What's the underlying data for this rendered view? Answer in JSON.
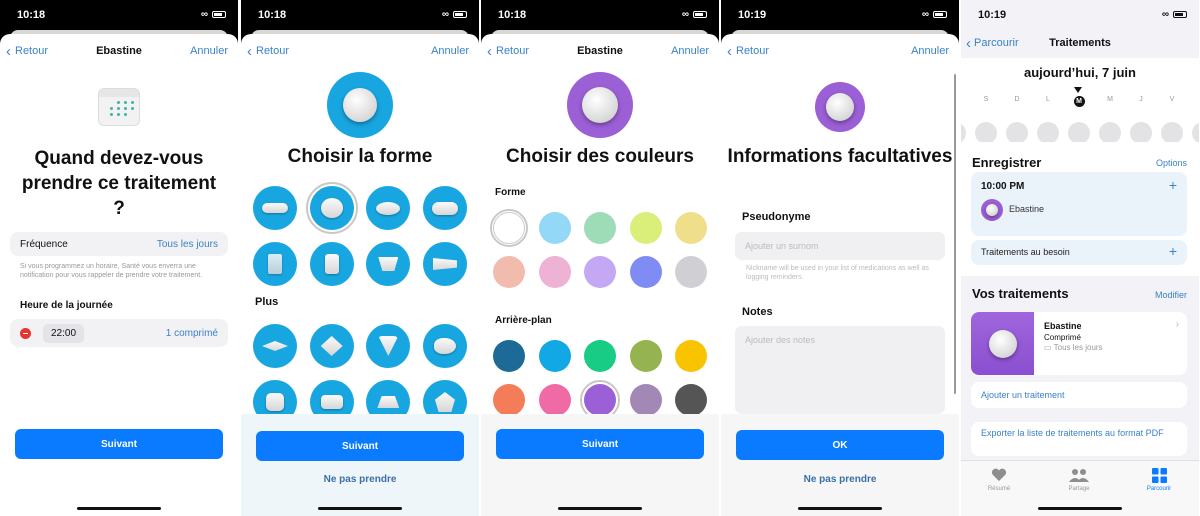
{
  "panels": [
    {
      "status_time": "10:18",
      "nav": {
        "back": "Retour",
        "title": "Ebastine",
        "cancel": "Annuler"
      },
      "heading": "Quand devez-vous prendre ce traitement ?",
      "frequency": {
        "label": "Fréquence",
        "value": "Tous les jours"
      },
      "note": "Si vous programmez un horaire, Santé vous enverra une notification pour vous rappeler de prendre votre traitement.",
      "time_section": "Heure de la journée",
      "dose": {
        "time": "22:00",
        "quantity": "1 comprimé"
      },
      "primary_button": "Suivant"
    },
    {
      "status_time": "10:18",
      "nav": {
        "back": "Retour",
        "cancel": "Annuler"
      },
      "heading": "Choisir la forme",
      "hero_color": "#17a6e0",
      "shapes_main": [
        "capsule",
        "round",
        "oval",
        "oblong",
        "jar",
        "bottle",
        "cup",
        "tube"
      ],
      "selected_shape": "round",
      "more_label": "Plus",
      "shapes_more": [
        "diamond-flat",
        "diamond",
        "triangle",
        "egg",
        "square",
        "rectangle",
        "trapezoid",
        "pentagon"
      ],
      "primary_button": "Suivant",
      "secondary_button": "Ne pas prendre"
    },
    {
      "status_time": "10:18",
      "nav": {
        "back": "Retour",
        "title": "Ebastine",
        "cancel": "Annuler"
      },
      "heading": "Choisir des couleurs",
      "hero_color": "#9b5fd6",
      "shape_label": "Forme",
      "shape_colors": [
        "#ffffff",
        "#93d8f6",
        "#9ddcb7",
        "#d9ef7a",
        "#f0df8a",
        "#f1bcae",
        "#eeb2d4",
        "#c4a8f4",
        "#7f8cf4",
        "#d0d0d4"
      ],
      "selected_shape_color": "#ffffff",
      "background_label": "Arrière-plan",
      "background_colors": [
        "#1e6a96",
        "#12a8e6",
        "#19cc86",
        "#95b451",
        "#f8c400",
        "#f47c58",
        "#f06aa6",
        "#9b5fd6",
        "#a288b4",
        "#555555"
      ],
      "selected_background_color": "#9b5fd6",
      "primary_button": "Suivant"
    },
    {
      "status_time": "10:19",
      "nav": {
        "back": "Retour",
        "cancel": "Annuler"
      },
      "heading": "Informations facultatives",
      "hero_color": "#9b5fd6",
      "nickname": {
        "label": "Pseudonyme",
        "placeholder": "Ajouter un surnom",
        "note": "Nickname will be used in your list of medications as well as logging reminders."
      },
      "notes": {
        "label": "Notes",
        "placeholder": "Ajouter des notes"
      },
      "primary_button": "OK",
      "secondary_button": "Ne pas prendre"
    },
    {
      "status_time": "10:19",
      "nav": {
        "back": "Parcourir",
        "title": "Traitements"
      },
      "date": "aujourd’hui, 7 juin",
      "week_days": [
        "S",
        "D",
        "L",
        "M",
        "M",
        "J",
        "V"
      ],
      "today_index": 3,
      "log": {
        "title": "Enregistrer",
        "options": "Options",
        "time": "10:00 PM",
        "medication": "Ebastine",
        "as_needed": "Traitements au besoin"
      },
      "your_meds": {
        "title": "Vos traitements",
        "edit": "Modifier",
        "item": {
          "name": "Ebastine",
          "form": "Comprimé",
          "frequency": "Tous les jours"
        },
        "add": "Ajouter un traitement",
        "export": "Exporter la liste de traitements au format PDF"
      },
      "tabs": [
        {
          "label": "Résumé",
          "icon": "heart-icon",
          "active": false
        },
        {
          "label": "Partage",
          "icon": "people-icon",
          "active": false
        },
        {
          "label": "Parcourir",
          "icon": "grid-icon",
          "active": true
        }
      ]
    }
  ]
}
